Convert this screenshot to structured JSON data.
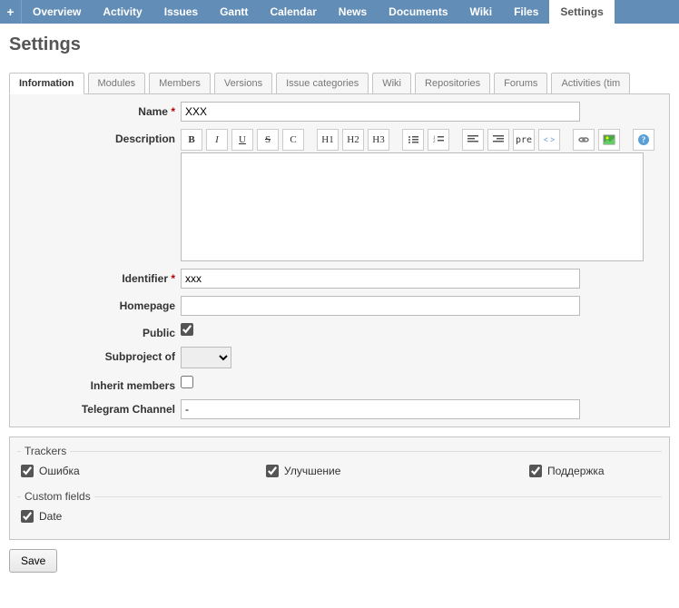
{
  "topnav": {
    "plus": "+",
    "tabs": [
      "Overview",
      "Activity",
      "Issues",
      "Gantt",
      "Calendar",
      "News",
      "Documents",
      "Wiki",
      "Files",
      "Settings"
    ],
    "active": "Settings"
  },
  "page_title": "Settings",
  "subtabs": {
    "items": [
      "Information",
      "Modules",
      "Members",
      "Versions",
      "Issue categories",
      "Wiki",
      "Repositories",
      "Forums",
      "Activities (tim"
    ],
    "active": "Information"
  },
  "form": {
    "name": {
      "label": "Name",
      "value": "XXX",
      "required": true
    },
    "description": {
      "label": "Description"
    },
    "identifier": {
      "label": "Identifier",
      "value": "xxx",
      "required": true
    },
    "homepage": {
      "label": "Homepage",
      "value": ""
    },
    "public": {
      "label": "Public",
      "checked": true
    },
    "subproject": {
      "label": "Subproject of",
      "value": ""
    },
    "inherit": {
      "label": "Inherit members",
      "checked": false
    },
    "telegram": {
      "label": "Telegram Channel",
      "value": "-"
    }
  },
  "toolbar_icons": {
    "bold": "B",
    "italic": "I",
    "underline": "U",
    "strike": "S",
    "code": "C",
    "h1": "H1",
    "h2": "H2",
    "h3": "H3",
    "ul": "bullet-list",
    "ol": "numbered-list",
    "left": "align-left",
    "right": "align-right",
    "pre": "pre",
    "html": "< >",
    "link": "link",
    "image": "image",
    "help": "?"
  },
  "trackers": {
    "legend": "Trackers",
    "items": [
      {
        "label": "Ошибка",
        "checked": true
      },
      {
        "label": "Улучшение",
        "checked": true
      },
      {
        "label": "Поддержка",
        "checked": true
      }
    ]
  },
  "custom_fields": {
    "legend": "Custom fields",
    "items": [
      {
        "label": "Date",
        "checked": true
      }
    ]
  },
  "save_label": "Save"
}
